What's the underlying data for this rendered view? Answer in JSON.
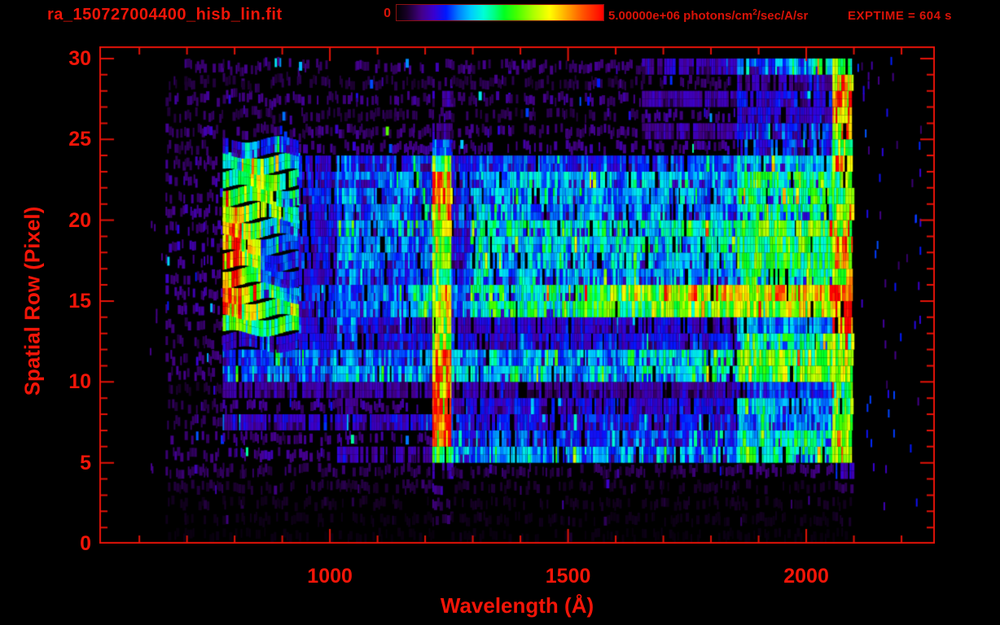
{
  "title": "ra_150727004400_hisb_lin.fit",
  "exptime_label": "EXPTIME = 604 s",
  "colorbar": {
    "min_label": "0",
    "max_label_prefix": "5.00000e+06 photons/cm",
    "max_label_sup": "2",
    "max_label_suffix": "/sec/A/sr"
  },
  "chart_data": {
    "type": "heatmap",
    "title": "ra_150727004400_hisb_lin.fit",
    "xlabel": "Wavelength (Å)",
    "ylabel": "Spatial Row (Pixel)",
    "xlim": [
      516,
      2270
    ],
    "ylim": [
      0,
      30.75
    ],
    "x_ticks_major": [
      1000,
      1500,
      2000
    ],
    "x_tick_labels": [
      "1000",
      "1500",
      "2000"
    ],
    "x_minor_step": 100,
    "x_minor_range": [
      600,
      2200
    ],
    "y_ticks_major": [
      0,
      5,
      10,
      15,
      20,
      25,
      30
    ],
    "y_tick_labels": [
      "0",
      "5",
      "10",
      "15",
      "20",
      "25",
      "30"
    ],
    "y_minor_step": 1,
    "colorbar_min": 0,
    "colorbar_max": 5000000,
    "colorbar_units": "photons/cm^2/sec/A/sr",
    "exptime_seconds": 604,
    "colormap_stops": [
      [
        0.0,
        "#000000"
      ],
      [
        0.05,
        "#180028"
      ],
      [
        0.12,
        "#440088"
      ],
      [
        0.18,
        "#3a00d0"
      ],
      [
        0.24,
        "#0018ff"
      ],
      [
        0.3,
        "#0080ff"
      ],
      [
        0.36,
        "#00ccff"
      ],
      [
        0.42,
        "#00ffd8"
      ],
      [
        0.47,
        "#00ff88"
      ],
      [
        0.52,
        "#00ff22"
      ],
      [
        0.58,
        "#44ff00"
      ],
      [
        0.66,
        "#aaff00"
      ],
      [
        0.74,
        "#ffff00"
      ],
      [
        0.82,
        "#ffaa00"
      ],
      [
        0.9,
        "#ff5500"
      ],
      [
        1.0,
        "#ff0000"
      ]
    ],
    "grid": {
      "wavelength_start": 655,
      "wavelength_step": 40,
      "row_start": 0,
      "value_scale": "percent_of_colorbar_max",
      "rows_bottom_to_top": [
        [
          2,
          2,
          2,
          2,
          2,
          2,
          2,
          2,
          2,
          2,
          2,
          2,
          2,
          2,
          4,
          2,
          2,
          2,
          2,
          2,
          2,
          2,
          2,
          2,
          2,
          2,
          2,
          2,
          2,
          2,
          2,
          2,
          2,
          2,
          2,
          2
        ],
        [
          3,
          3,
          3,
          3,
          3,
          3,
          3,
          3,
          3,
          3,
          3,
          3,
          3,
          3,
          8,
          3,
          3,
          3,
          3,
          3,
          3,
          3,
          3,
          3,
          3,
          3,
          3,
          3,
          3,
          3,
          3,
          3,
          3,
          3,
          3,
          5
        ],
        [
          4,
          4,
          4,
          4,
          4,
          4,
          4,
          4,
          4,
          4,
          4,
          4,
          4,
          4,
          10,
          4,
          4,
          4,
          4,
          4,
          4,
          4,
          4,
          4,
          4,
          4,
          4,
          4,
          4,
          4,
          4,
          4,
          4,
          4,
          4,
          4
        ],
        [
          6,
          6,
          6,
          6,
          6,
          6,
          6,
          6,
          6,
          6,
          6,
          6,
          6,
          8,
          12,
          5,
          5,
          5,
          5,
          5,
          5,
          5,
          5,
          5,
          5,
          5,
          5,
          5,
          5,
          5,
          5,
          5,
          5,
          5,
          5,
          8
        ],
        [
          8,
          8,
          8,
          8,
          8,
          8,
          8,
          8,
          8,
          10,
          8,
          8,
          8,
          8,
          15,
          8,
          8,
          8,
          8,
          8,
          8,
          8,
          8,
          8,
          8,
          8,
          8,
          8,
          8,
          8,
          10,
          10,
          10,
          10,
          10,
          20
        ],
        [
          10,
          10,
          10,
          12,
          12,
          12,
          12,
          12,
          12,
          15,
          15,
          15,
          15,
          15,
          50,
          32,
          32,
          32,
          32,
          32,
          32,
          32,
          32,
          32,
          32,
          32,
          32,
          32,
          32,
          32,
          45,
          45,
          45,
          45,
          45,
          60
        ],
        [
          10,
          10,
          10,
          10,
          10,
          10,
          10,
          10,
          10,
          12,
          12,
          12,
          12,
          12,
          80,
          25,
          25,
          25,
          25,
          25,
          25,
          25,
          25,
          25,
          25,
          25,
          25,
          25,
          25,
          25,
          42,
          42,
          42,
          42,
          42,
          60
        ],
        [
          8,
          8,
          8,
          18,
          18,
          18,
          18,
          18,
          18,
          18,
          18,
          18,
          18,
          18,
          80,
          22,
          22,
          22,
          22,
          22,
          22,
          22,
          22,
          22,
          22,
          22,
          22,
          22,
          22,
          22,
          30,
          30,
          30,
          30,
          30,
          55
        ],
        [
          8,
          8,
          8,
          12,
          12,
          12,
          12,
          12,
          12,
          14,
          12,
          12,
          12,
          12,
          82,
          20,
          20,
          20,
          20,
          20,
          20,
          20,
          20,
          20,
          20,
          20,
          20,
          20,
          20,
          20,
          35,
          35,
          35,
          35,
          35,
          55
        ],
        [
          6,
          6,
          6,
          13,
          13,
          13,
          13,
          13,
          13,
          14,
          13,
          13,
          13,
          13,
          80,
          15,
          15,
          15,
          15,
          15,
          15,
          15,
          15,
          15,
          15,
          15,
          15,
          15,
          15,
          15,
          25,
          25,
          25,
          25,
          25,
          50
        ],
        [
          10,
          10,
          10,
          28,
          28,
          28,
          28,
          28,
          28,
          32,
          33,
          33,
          33,
          33,
          83,
          36,
          36,
          36,
          36,
          36,
          36,
          36,
          36,
          36,
          36,
          42,
          42,
          42,
          42,
          42,
          58,
          58,
          58,
          58,
          58,
          65
        ],
        [
          10,
          10,
          10,
          28,
          28,
          28,
          28,
          28,
          28,
          30,
          30,
          30,
          30,
          30,
          85,
          33,
          33,
          33,
          33,
          33,
          33,
          33,
          33,
          33,
          33,
          40,
          40,
          40,
          40,
          40,
          58,
          58,
          58,
          58,
          58,
          65
        ],
        [
          8,
          8,
          8,
          18,
          18,
          18,
          18,
          18,
          18,
          25,
          20,
          20,
          20,
          20,
          70,
          20,
          20,
          20,
          20,
          20,
          20,
          20,
          20,
          20,
          20,
          22,
          22,
          22,
          22,
          22,
          48,
          48,
          48,
          48,
          48,
          60
        ],
        [
          10,
          10,
          10,
          55,
          50,
          50,
          50,
          20,
          20,
          28,
          20,
          20,
          20,
          20,
          65,
          18,
          18,
          18,
          18,
          18,
          18,
          18,
          18,
          18,
          18,
          18,
          18,
          18,
          18,
          18,
          30,
          30,
          30,
          30,
          30,
          85
        ],
        [
          12,
          12,
          12,
          85,
          60,
          50,
          50,
          22,
          22,
          30,
          28,
          28,
          28,
          40,
          68,
          30,
          45,
          45,
          45,
          45,
          45,
          45,
          55,
          55,
          55,
          55,
          60,
          60,
          60,
          60,
          60,
          60,
          65,
          65,
          65,
          90
        ],
        [
          12,
          12,
          12,
          90,
          62,
          45,
          30,
          22,
          22,
          30,
          30,
          30,
          30,
          40,
          60,
          30,
          45,
          45,
          45,
          45,
          45,
          45,
          62,
          62,
          62,
          62,
          75,
          75,
          75,
          75,
          75,
          75,
          80,
          80,
          80,
          92
        ],
        [
          12,
          12,
          12,
          90,
          60,
          30,
          25,
          20,
          20,
          30,
          25,
          25,
          25,
          25,
          58,
          22,
          38,
          33,
          33,
          33,
          33,
          33,
          33,
          33,
          33,
          33,
          33,
          33,
          33,
          33,
          45,
          45,
          45,
          45,
          45,
          70
        ],
        [
          12,
          12,
          12,
          88,
          58,
          28,
          25,
          20,
          20,
          32,
          28,
          28,
          28,
          28,
          58,
          22,
          40,
          35,
          35,
          35,
          35,
          35,
          35,
          35,
          35,
          35,
          35,
          35,
          35,
          35,
          50,
          50,
          50,
          50,
          50,
          70
        ],
        [
          12,
          12,
          12,
          88,
          60,
          30,
          28,
          22,
          22,
          32,
          28,
          28,
          28,
          28,
          62,
          22,
          42,
          38,
          38,
          38,
          38,
          38,
          38,
          38,
          38,
          38,
          38,
          38,
          38,
          38,
          52,
          52,
          52,
          52,
          52,
          75
        ],
        [
          12,
          12,
          12,
          85,
          62,
          45,
          30,
          22,
          22,
          34,
          30,
          30,
          30,
          30,
          75,
          24,
          42,
          42,
          42,
          42,
          42,
          42,
          42,
          42,
          42,
          42,
          42,
          42,
          42,
          42,
          55,
          55,
          55,
          55,
          55,
          60
        ],
        [
          12,
          12,
          12,
          75,
          60,
          55,
          40,
          22,
          22,
          30,
          26,
          26,
          26,
          26,
          80,
          24,
          38,
          30,
          30,
          30,
          30,
          30,
          30,
          30,
          30,
          30,
          30,
          30,
          30,
          30,
          45,
          45,
          45,
          45,
          45,
          70
        ],
        [
          12,
          12,
          12,
          60,
          58,
          55,
          45,
          22,
          22,
          32,
          28,
          28,
          28,
          28,
          82,
          24,
          32,
          32,
          32,
          32,
          32,
          32,
          32,
          32,
          32,
          32,
          32,
          32,
          32,
          32,
          45,
          45,
          45,
          45,
          45,
          55
        ],
        [
          12,
          12,
          12,
          50,
          65,
          60,
          45,
          22,
          22,
          30,
          28,
          28,
          28,
          28,
          80,
          24,
          34,
          34,
          34,
          34,
          34,
          34,
          34,
          34,
          34,
          34,
          34,
          34,
          34,
          34,
          48,
          48,
          48,
          48,
          48,
          55
        ],
        [
          10,
          10,
          10,
          40,
          55,
          50,
          40,
          20,
          20,
          28,
          24,
          24,
          24,
          24,
          55,
          20,
          26,
          26,
          26,
          26,
          26,
          26,
          26,
          26,
          26,
          26,
          26,
          26,
          26,
          26,
          38,
          38,
          38,
          38,
          38,
          85
        ],
        [
          8,
          8,
          8,
          20,
          35,
          30,
          25,
          12,
          12,
          12,
          12,
          12,
          12,
          12,
          30,
          12,
          12,
          12,
          12,
          12,
          12,
          12,
          12,
          12,
          12,
          12,
          12,
          12,
          12,
          12,
          25,
          25,
          25,
          25,
          25,
          60
        ],
        [
          10,
          10,
          10,
          10,
          10,
          10,
          10,
          10,
          10,
          10,
          10,
          10,
          10,
          10,
          14,
          10,
          10,
          10,
          10,
          10,
          10,
          10,
          10,
          10,
          10,
          14,
          14,
          14,
          14,
          14,
          22,
          22,
          22,
          22,
          22,
          75
        ],
        [
          8,
          8,
          8,
          8,
          8,
          8,
          8,
          8,
          8,
          8,
          8,
          8,
          8,
          8,
          12,
          8,
          8,
          8,
          8,
          8,
          8,
          8,
          8,
          8,
          8,
          12,
          12,
          12,
          12,
          12,
          18,
          18,
          18,
          18,
          18,
          85
        ],
        [
          11,
          11,
          11,
          11,
          11,
          11,
          11,
          11,
          11,
          11,
          11,
          11,
          11,
          11,
          14,
          11,
          11,
          11,
          11,
          11,
          11,
          11,
          11,
          11,
          11,
          14,
          14,
          14,
          14,
          14,
          20,
          20,
          20,
          20,
          20,
          85
        ],
        [
          7,
          7,
          7,
          7,
          7,
          7,
          7,
          7,
          7,
          7,
          7,
          7,
          7,
          7,
          10,
          7,
          7,
          7,
          7,
          7,
          7,
          7,
          7,
          7,
          7,
          9,
          9,
          9,
          9,
          9,
          14,
          14,
          14,
          14,
          14,
          80
        ],
        [
          0,
          10,
          10,
          10,
          10,
          10,
          10,
          10,
          10,
          10,
          10,
          10,
          10,
          10,
          12,
          10,
          10,
          10,
          10,
          10,
          10,
          10,
          10,
          10,
          10,
          16,
          16,
          16,
          16,
          16,
          30,
          30,
          30,
          30,
          45,
          55
        ],
        [
          0,
          0,
          0,
          0,
          0,
          0,
          0,
          0,
          0,
          0,
          0,
          0,
          0,
          0,
          0,
          0,
          0,
          0,
          0,
          0,
          0,
          0,
          0,
          0,
          0,
          0,
          0,
          0,
          0,
          0,
          0,
          0,
          0,
          0,
          0,
          0
        ]
      ]
    }
  }
}
